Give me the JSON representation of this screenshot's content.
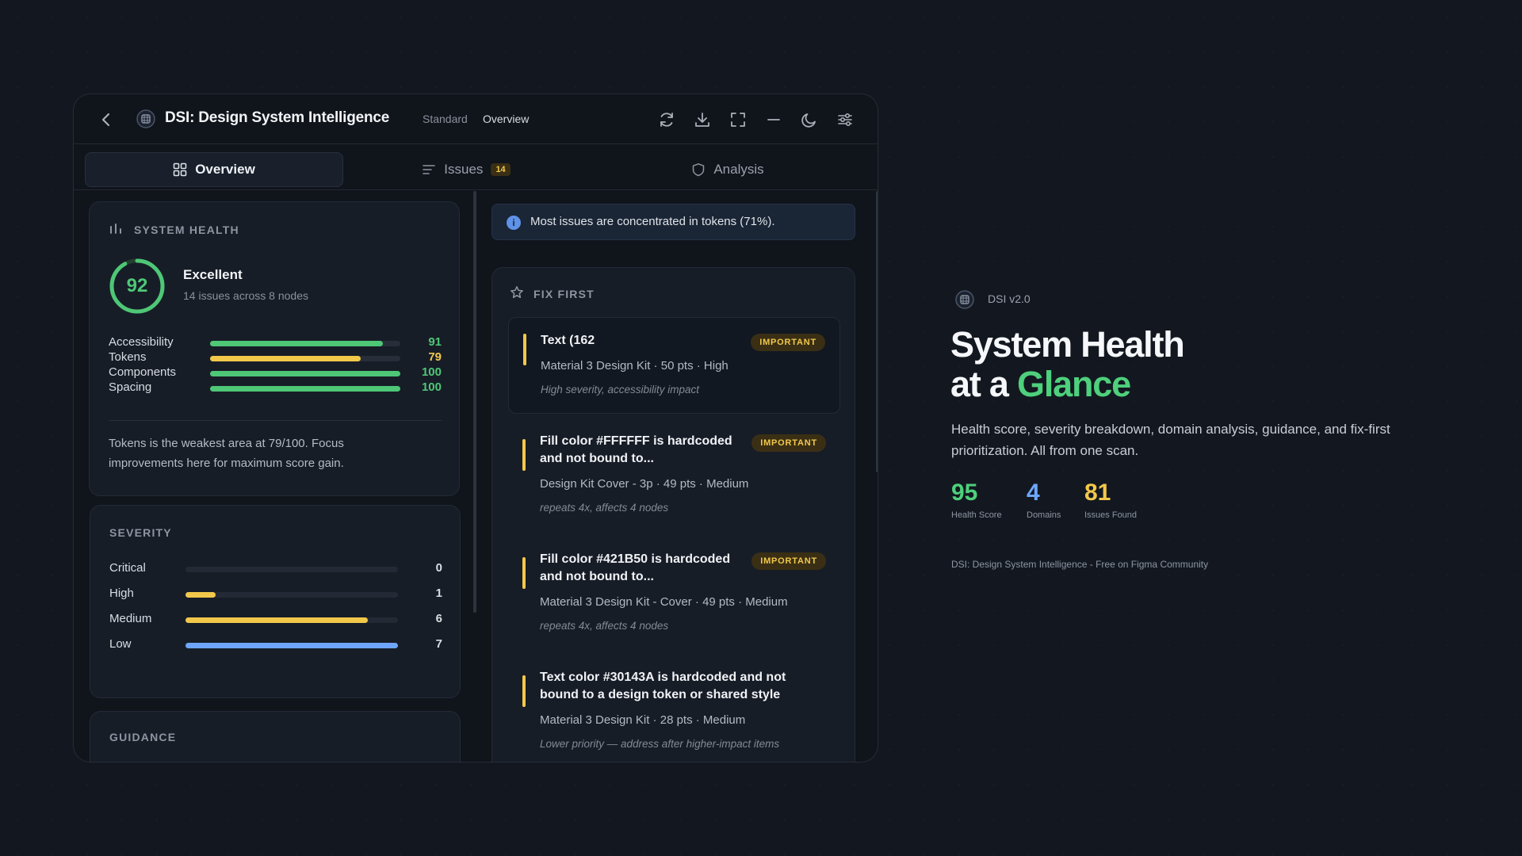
{
  "window": {
    "title": "DSI: Design System Intelligence",
    "breadcrumb": [
      "Standard",
      "Overview"
    ],
    "toolbar_icons": [
      "refresh-icon",
      "download-icon",
      "fullscreen-icon",
      "minimize-icon",
      "theme-moon-icon",
      "settings-sliders-icon"
    ]
  },
  "tabs": [
    {
      "label": "Overview",
      "active": true
    },
    {
      "label": "Issues",
      "badge": "14"
    },
    {
      "label": "Analysis"
    }
  ],
  "health": {
    "title": "SYSTEM HEALTH",
    "score": "92",
    "score_fraction": 0.92,
    "status": "Excellent",
    "subtitle": "14 issues across 8 nodes",
    "metrics": [
      {
        "label": "Accessibility",
        "value": "91",
        "fraction": 0.91,
        "color": "#4ec776"
      },
      {
        "label": "Tokens",
        "value": "79",
        "fraction": 0.79,
        "color": "#f2c84b"
      },
      {
        "label": "Components",
        "value": "100",
        "fraction": 1.0,
        "color": "#4ec776"
      },
      {
        "label": "Spacing",
        "value": "100",
        "fraction": 1.0,
        "color": "#4ec776"
      }
    ],
    "note": "Tokens is the weakest area at 79/100. Focus improvements here for maximum score gain."
  },
  "severity": {
    "title": "SEVERITY",
    "rows": [
      {
        "label": "Critical",
        "value": "0",
        "fraction": 0.0,
        "color": "#e5534b"
      },
      {
        "label": "High",
        "value": "1",
        "fraction": 0.14,
        "color": "#f2c84b"
      },
      {
        "label": "Medium",
        "value": "6",
        "fraction": 0.86,
        "color": "#f2c84b"
      },
      {
        "label": "Low",
        "value": "7",
        "fraction": 1.0,
        "color": "#6ea6ff"
      }
    ]
  },
  "guidance": {
    "title": "GUIDANCE"
  },
  "info_banner": {
    "text": "Most issues are concentrated in tokens (71%)."
  },
  "fix_first": {
    "title": "FIX FIRST",
    "items": [
      {
        "title": "Text (162",
        "badge": "IMPORTANT",
        "meta": "Material 3 Design Kit · 50 pts · High",
        "note": "High severity, accessibility impact"
      },
      {
        "title": "Fill color #FFFFFF is hardcoded and not bound to...",
        "badge": "IMPORTANT",
        "meta": "Design Kit Cover - 3p · 49 pts · Medium",
        "note": "repeats 4x, affects 4 nodes"
      },
      {
        "title": "Fill color #421B50 is hardcoded and not bound to...",
        "badge": "IMPORTANT",
        "meta": "Material 3 Design Kit - Cover · 49 pts · Medium",
        "note": "repeats 4x, affects 4 nodes"
      },
      {
        "title": "Text color #30143A is hardcoded and not bound to a design token or shared style",
        "meta": "Material 3 Design Kit · 28 pts · Medium",
        "note": "Lower priority — address after higher-impact items"
      }
    ]
  },
  "promo": {
    "version": "DSI v2.0",
    "title_line1": "System Health",
    "title_line2_prefix": "at a ",
    "title_highlight": "Glance",
    "description": "Health score, severity breakdown, domain analysis, guidance, and fix-first prioritization. All from one scan.",
    "stats": [
      {
        "value": "95",
        "label": "Health Score",
        "color": "#4ed07c"
      },
      {
        "value": "4",
        "label": "Domains",
        "color": "#6ea6ff"
      },
      {
        "value": "81",
        "label": "Issues Found",
        "color": "#f2c84b"
      }
    ],
    "footer": "DSI: Design System Intelligence - Free on Figma Community"
  }
}
